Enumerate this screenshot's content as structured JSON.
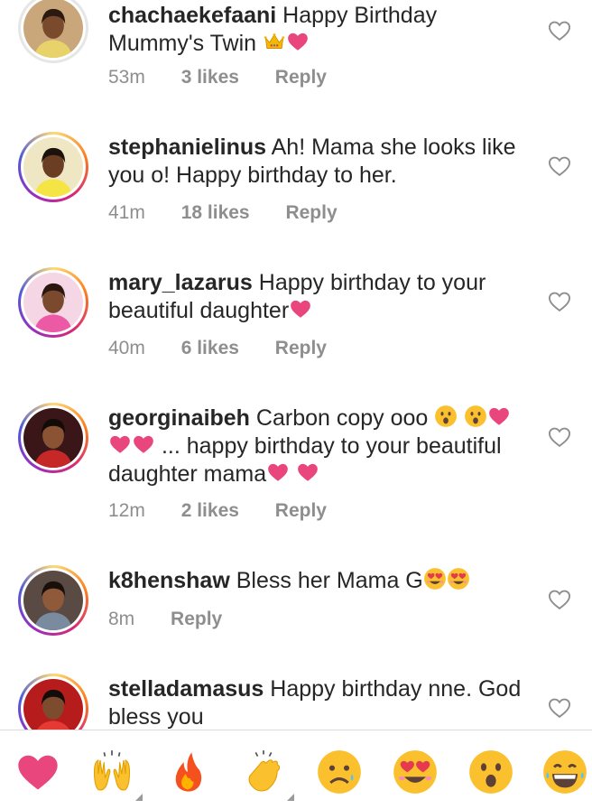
{
  "comments": [
    {
      "username": "chachaekefaani",
      "text": "Happy Birthday Mummy's Twin",
      "emojis": [
        "crown-emoji",
        "heart-emoji"
      ],
      "time": "53m",
      "likes": "3 likes",
      "reply": "Reply",
      "avatar_ring": "plain"
    },
    {
      "username": "stephanielinus",
      "text": "Ah! Mama she looks like you o! Happy birthday to her.",
      "emojis": [],
      "time": "41m",
      "likes": "18 likes",
      "reply": "Reply",
      "avatar_ring": "story"
    },
    {
      "username": "mary_lazarus",
      "text": "Happy birthday to your beautiful daughter",
      "emojis": [
        "heart-emoji"
      ],
      "time": "40m",
      "likes": "6 likes",
      "reply": "Reply",
      "avatar_ring": "story"
    },
    {
      "username": "georginaibeh",
      "text_part1": "Carbon copy ooo",
      "text_part2": "... happy birthday to your beautiful daughter mama",
      "time": "12m",
      "likes": "2 likes",
      "reply": "Reply",
      "avatar_ring": "story"
    },
    {
      "username": "k8henshaw",
      "text": "Bless her Mama G",
      "emojis": [
        "heart-eyes-emoji",
        "heart-eyes-emoji"
      ],
      "time": "8m",
      "reply": "Reply",
      "avatar_ring": "story"
    },
    {
      "username": "stelladamasus",
      "text": "Happy birthday nne. God bless you",
      "time": "",
      "avatar_ring": "story"
    }
  ],
  "emoji_bar": [
    "red-heart-emoji",
    "raised-hands-emoji",
    "fire-emoji",
    "clapping-hands-emoji",
    "crying-face-emoji",
    "heart-eyes-face-emoji",
    "surprised-face-emoji",
    "laughing-face-emoji"
  ],
  "colors": {
    "heart_pink": "#e8467c",
    "meta_gray": "#8e8e8e",
    "text": "#262626",
    "emoji_yellow": "#fbc02d"
  }
}
